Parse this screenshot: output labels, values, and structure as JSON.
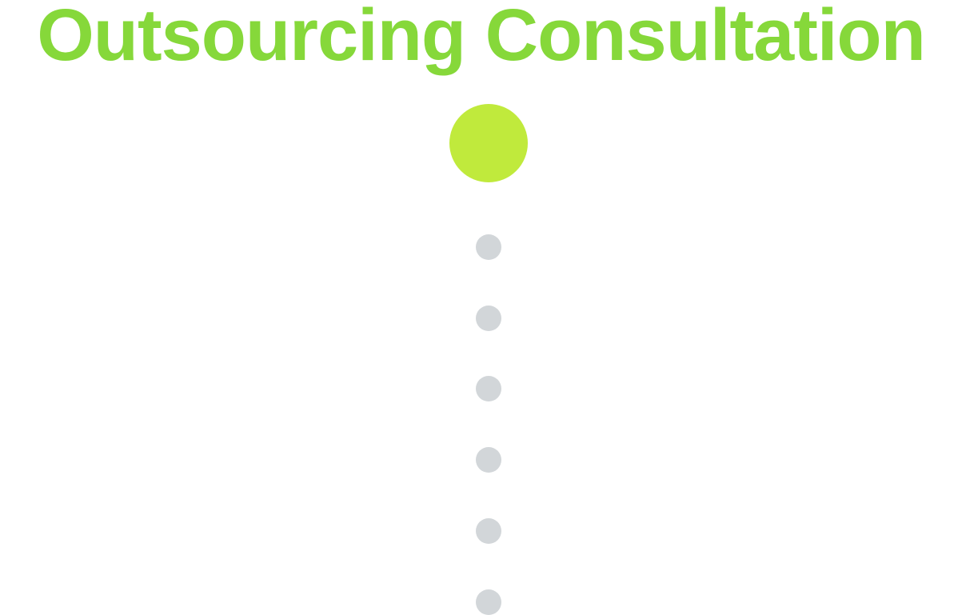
{
  "header": {
    "title": "Outsourcing Consultation"
  },
  "colors": {
    "title": "#86d83a",
    "active_step": "#c0ea3c",
    "inactive_step": "#d2d6d9",
    "background": "#ffffff"
  },
  "steps": {
    "count": 7,
    "active_index": 0
  }
}
